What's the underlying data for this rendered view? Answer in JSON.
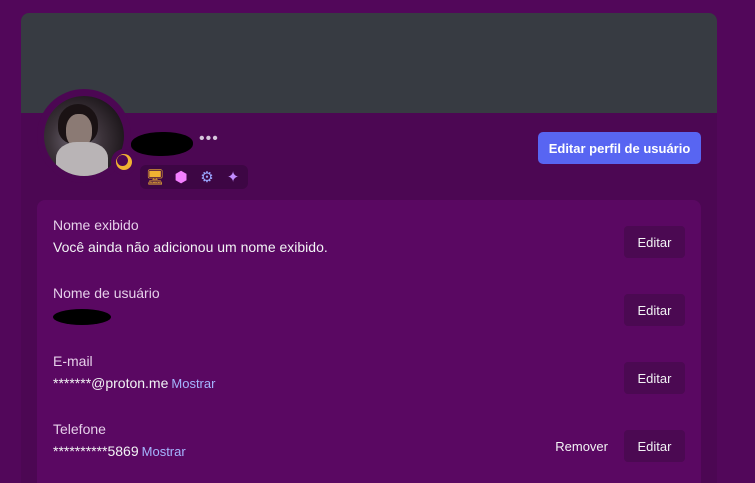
{
  "profile": {
    "more_icon": "more-horizontal-icon",
    "status": "idle",
    "badges": [
      {
        "icon": "monitor-badge-icon",
        "glyph": "🖥"
      },
      {
        "icon": "hypesquad-badge-icon",
        "glyph": "⬢"
      },
      {
        "icon": "nitro-badge-icon",
        "glyph": "⚙"
      },
      {
        "icon": "quest-badge-icon",
        "glyph": "✦"
      }
    ],
    "edit_profile_label": "Editar perfil de usuário"
  },
  "fields": {
    "display_name": {
      "label": "Nome exibido",
      "value": "Você ainda não adicionou um nome exibido.",
      "edit_label": "Editar"
    },
    "username": {
      "label": "Nome de usuário",
      "edit_label": "Editar"
    },
    "email": {
      "label": "E-mail",
      "value": "*******@proton.me",
      "reveal_label": "Mostrar",
      "edit_label": "Editar"
    },
    "phone": {
      "label": "Telefone",
      "value": "**********5869",
      "reveal_label": "Mostrar",
      "remove_label": "Remover",
      "edit_label": "Editar"
    }
  },
  "colors": {
    "background": "#52075a",
    "banner": "#373b42",
    "accent": "#5865f2",
    "link": "#a5b6ff",
    "idle_status": "#f0b232"
  }
}
